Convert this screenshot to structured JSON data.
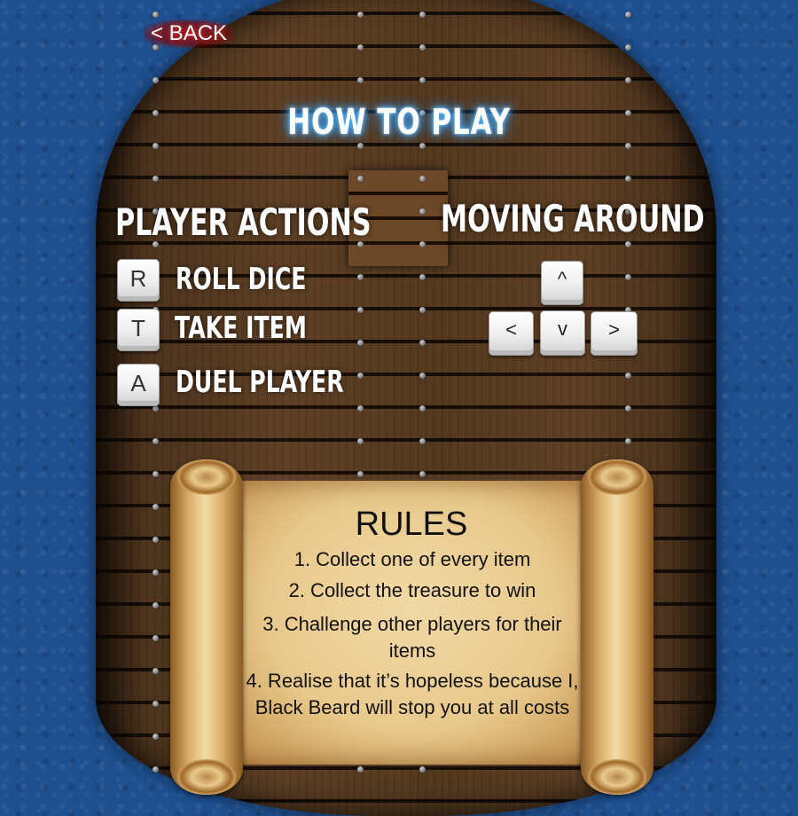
{
  "header": {
    "back_label": "< BACK",
    "title": "HOW TO PLAY"
  },
  "player_actions": {
    "heading": "PLAYER ACTIONS",
    "items": [
      {
        "key": "R",
        "label": "ROLL DICE"
      },
      {
        "key": "T",
        "label": "TAKE ITEM"
      },
      {
        "key": "A",
        "label": "DUEL PLAYER"
      }
    ]
  },
  "moving_around": {
    "heading": "MOVING AROUND",
    "keys": {
      "up": "^",
      "left": "<",
      "down": "v",
      "right": ">"
    }
  },
  "rules": {
    "title": "RULES",
    "items": [
      "1. Collect one of every item",
      "2. Collect the treasure to win",
      "3. Challenge other players for their items",
      "4. Realise that it’s hopeless because I, Black Beard will stop you at all costs"
    ]
  },
  "colors": {
    "sea": "#1e4f8f",
    "deck": "#4a311b",
    "title_glow": "#4db6ff",
    "parchment": "#e8c98c",
    "back_glow": "#960a0a"
  },
  "icons": {
    "keys": "keyboard-key-icon",
    "scroll": "parchment-scroll-icon"
  }
}
